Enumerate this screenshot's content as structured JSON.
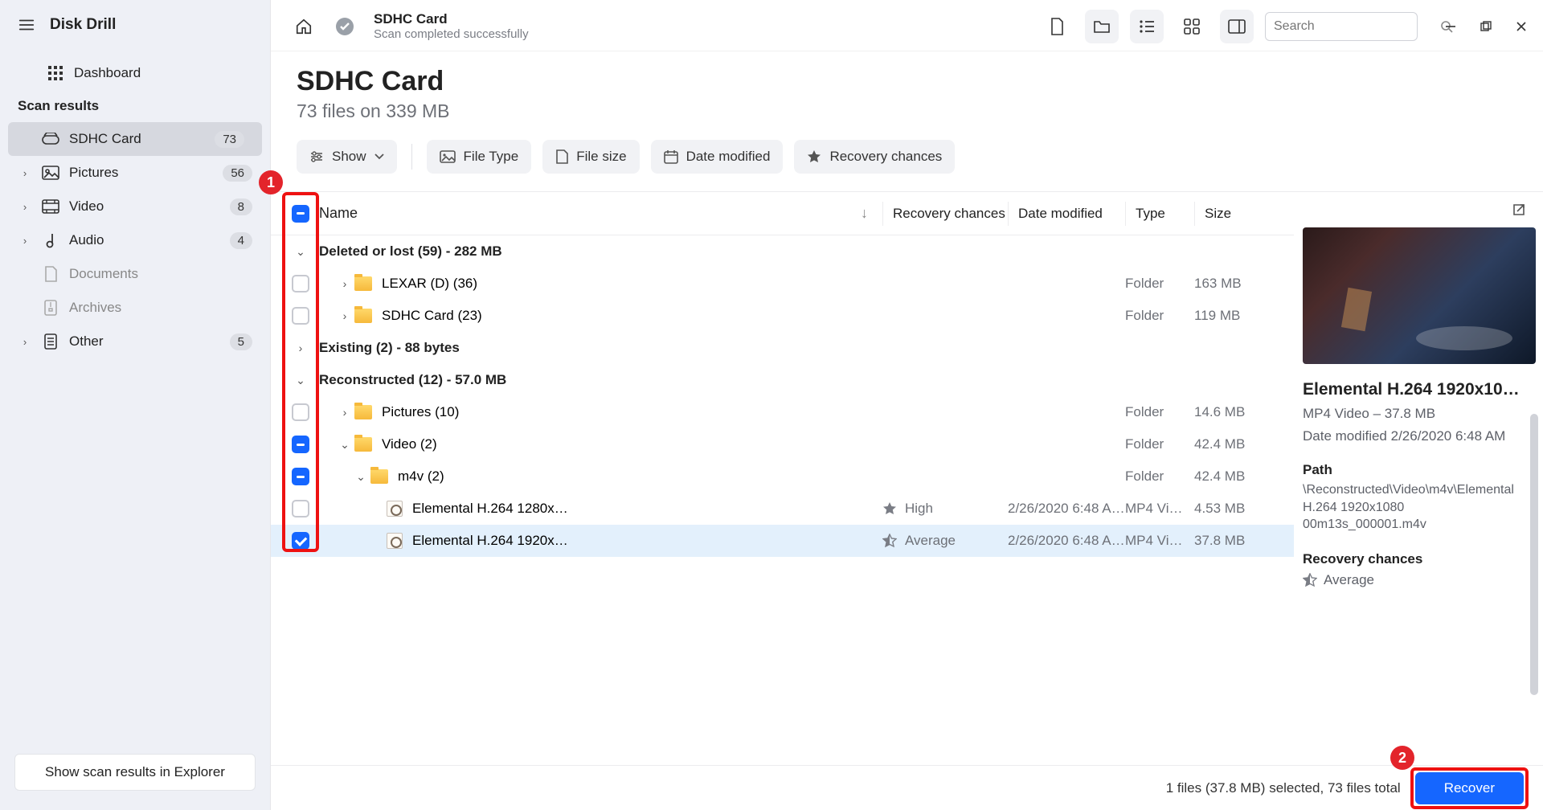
{
  "brand": "Disk Drill",
  "sidebar": {
    "dashboard": "Dashboard",
    "section": "Scan results",
    "items": [
      {
        "label": "SDHC Card",
        "count": "73",
        "active": true,
        "icon": "drive"
      },
      {
        "label": "Pictures",
        "count": "56",
        "icon": "image"
      },
      {
        "label": "Video",
        "count": "8",
        "icon": "video"
      },
      {
        "label": "Audio",
        "count": "4",
        "icon": "audio"
      },
      {
        "label": "Documents",
        "count": "",
        "icon": "doc",
        "muted": true
      },
      {
        "label": "Archives",
        "count": "",
        "icon": "archive",
        "muted": true
      },
      {
        "label": "Other",
        "count": "5",
        "icon": "other"
      }
    ],
    "footer_btn": "Show scan results in Explorer"
  },
  "topbar": {
    "title": "SDHC Card",
    "subtitle": "Scan completed successfully",
    "search_placeholder": "Search"
  },
  "page": {
    "title": "SDHC Card",
    "subtitle": "73 files on 339 MB"
  },
  "filters": {
    "show": "Show",
    "file_type": "File Type",
    "file_size": "File size",
    "date_modified": "Date modified",
    "recovery": "Recovery chances"
  },
  "columns": {
    "name": "Name",
    "recovery": "Recovery chances",
    "date": "Date modified",
    "type": "Type",
    "size": "Size"
  },
  "groups": {
    "deleted": "Deleted or lost (59) - 282 MB",
    "existing": "Existing (2) - 88 bytes",
    "reconstructed": "Reconstructed (12) - 57.0 MB"
  },
  "rows": {
    "lexar": {
      "name": "LEXAR (D) (36)",
      "type": "Folder",
      "size": "163 MB"
    },
    "sdhc": {
      "name": "SDHC Card (23)",
      "type": "Folder",
      "size": "119 MB"
    },
    "pictures": {
      "name": "Pictures (10)",
      "type": "Folder",
      "size": "14.6 MB"
    },
    "video": {
      "name": "Video (2)",
      "type": "Folder",
      "size": "42.4 MB"
    },
    "m4v": {
      "name": "m4v (2)",
      "type": "Folder",
      "size": "42.4 MB"
    },
    "f1": {
      "name": "Elemental H.264 1280x…",
      "rec": "High",
      "date": "2/26/2020 6:48 A…",
      "type": "MP4 Vi…",
      "size": "4.53 MB"
    },
    "f2": {
      "name": "Elemental H.264 1920x…",
      "rec": "Average",
      "date": "2/26/2020 6:48 A…",
      "type": "MP4 Vi…",
      "size": "37.8 MB"
    }
  },
  "preview": {
    "title": "Elemental H.264 1920x10…",
    "line1": "MP4 Video – 37.8 MB",
    "line2": "Date modified 2/26/2020 6:48 AM",
    "path_label": "Path",
    "path_value": "\\Reconstructed\\Video\\m4v\\Elemental H.264 1920x1080 00m13s_000001.m4v",
    "rec_label": "Recovery chances",
    "rec_value": "Average"
  },
  "footer": {
    "status": "1 files (37.8 MB) selected, 73 files total",
    "recover": "Recover"
  },
  "annotations": {
    "one": "1",
    "two": "2"
  }
}
